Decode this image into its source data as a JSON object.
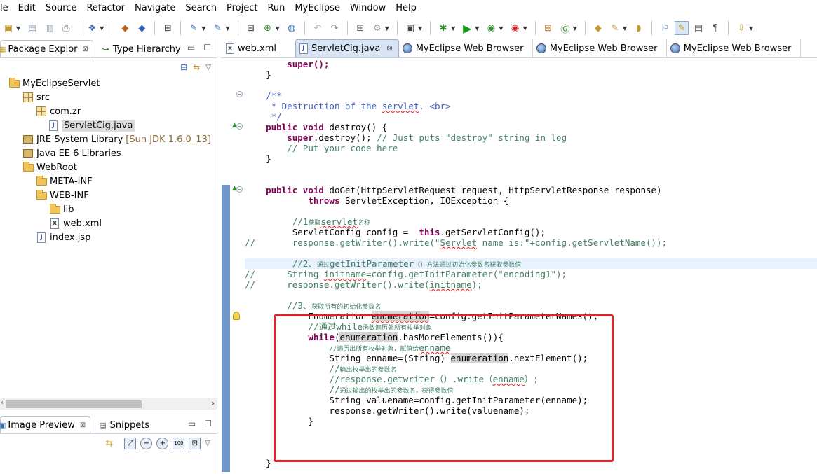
{
  "menu": [
    "le",
    "Edit",
    "Source",
    "Refactor",
    "Navigate",
    "Search",
    "Project",
    "Run",
    "MyEclipse",
    "Window",
    "Help"
  ],
  "left_panel": {
    "tabs": [
      {
        "label": "Package Explor",
        "close": "⊠"
      },
      {
        "label": "Type Hierarchy"
      }
    ],
    "min_label": "▭",
    "max_label": "☐",
    "tree": [
      {
        "label": "MyEclipseServlet",
        "icon": "project-icon"
      },
      {
        "label": "src",
        "icon": "source-folder-icon"
      },
      {
        "label": "com.zr",
        "icon": "package-icon"
      },
      {
        "label": "ServletCig.java",
        "icon": "java-file-icon"
      },
      {
        "label": "JRE System Library",
        "extra": "[Sun JDK 1.6.0_13]",
        "icon": "library-icon"
      },
      {
        "label": "Java EE 6 Libraries",
        "icon": "library-icon"
      },
      {
        "label": "WebRoot",
        "icon": "folder-icon"
      },
      {
        "label": "META-INF",
        "icon": "folder-icon"
      },
      {
        "label": "WEB-INF",
        "icon": "folder-icon"
      },
      {
        "label": "lib",
        "icon": "folder-icon"
      },
      {
        "label": "web.xml",
        "icon": "xml-file-icon"
      },
      {
        "label": "index.jsp",
        "icon": "jsp-file-icon"
      }
    ],
    "preview_tabs": [
      {
        "label": "Image Preview",
        "close": "⊠"
      },
      {
        "label": "Snippets"
      }
    ]
  },
  "editor": {
    "tabs": [
      {
        "label": "web.xml",
        "icon": "xml-file-icon"
      },
      {
        "label": "ServletCig.java",
        "icon": "java-file-icon",
        "active": true,
        "close": "⊠"
      },
      {
        "label": "MyEclipse Web Browser",
        "icon": "globe-icon"
      },
      {
        "label": "MyEclipse Web Browser",
        "icon": "globe-icon"
      },
      {
        "label": "MyEclipse Web Browser",
        "icon": "globe-icon"
      }
    ]
  },
  "code": {
    "l01": "super();",
    "l02": "}",
    "l03": "/**",
    "l04a": " * Destruction of the ",
    "l04b": "servlet",
    "l04c": ". <br>",
    "l05": " */",
    "l06a": "public void",
    "l06b": " destroy() {",
    "l07a": "super",
    "l07b": ".destroy(); ",
    "l07c": "// Just puts \"destroy\" string in log",
    "l08": "// Put your code here",
    "l09": "}",
    "l10a": "public void",
    "l10b": " doGet(HttpServletRequest request, HttpServletResponse response)",
    "l11a": "throws",
    "l11b": " ServletException, IOException {",
    "l12a": "//1",
    "l12b": "获取",
    "l12c": "servlet",
    "l12d": "名称",
    "l13a": "ServletConfig config =  ",
    "l13b": "this",
    "l13c": ".getServletConfig();",
    "l14a": "//       response.getWriter().write(\"",
    "l14b": "Servlet",
    "l14c": " name is:\"+config.getServletName());",
    "l15a": "//2、",
    "l15b": "通过",
    "l15c": "getInitParameter",
    "l15d": "（）方法通过初始化参数名获取参数值",
    "l16a": "//      String ",
    "l16b": "initname",
    "l16c": "=config.getInitParameter(\"encoding1\");",
    "l17a": "//      response.getWriter().write(",
    "l17b": "initname",
    "l17c": ");",
    "l18a": "//3、",
    "l18b": "获取所有的初始化参数名",
    "l19a": "Enumeration ",
    "l19b": "enumeration",
    "l19c": "=config.getInitParameterNames();",
    "l20a": "//通过",
    "l20b": "while",
    "l20c": "函数遍历处所有枚举对象",
    "l21a": "while",
    "l21b": "(",
    "l21c": "enumeration",
    "l21d": ".hasMoreElements()){",
    "l22a": "//遍历出所有枚举对象，赋值给",
    "l22b": "enname",
    "l23a": "String enname=(String) ",
    "l23b": "enumeration",
    "l23c": ".nextElement();",
    "l24a": "//",
    "l24b": "输出枚举出的参数名",
    "l25a": "//response.getwriter（）.write（",
    "l25b": "enname",
    "l25c": "）;",
    "l26a": "//",
    "l26b": "通过输出的枚举出的参数名，获得参数值",
    "l27": "String valuename=config.getInitParameter(enname);",
    "l28": "response.getWriter().write(valuename);",
    "l29": "}",
    "l30": "}"
  }
}
